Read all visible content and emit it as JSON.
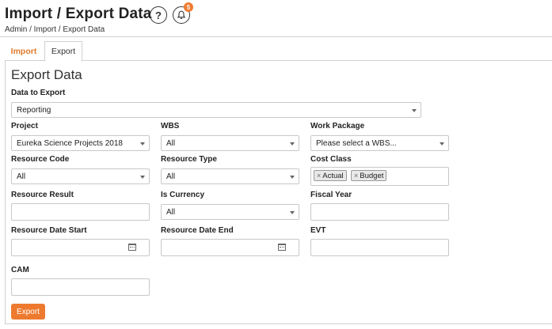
{
  "header": {
    "title": "Import / Export Data",
    "breadcrumb": "Admin  /  Import / Export Data",
    "help_glyph": "?",
    "notification_count": "5",
    "accent_color": "#ee7a2f"
  },
  "tabs": [
    {
      "label": "Import",
      "active": false
    },
    {
      "label": "Export",
      "active": true
    }
  ],
  "form": {
    "section_title": "Export Data",
    "data_to_export": {
      "label": "Data to Export",
      "value": "Reporting"
    },
    "project": {
      "label": "Project",
      "value": "Eureka Science Projects 2018"
    },
    "wbs": {
      "label": "WBS",
      "value": "All"
    },
    "work_package": {
      "label": "Work Package",
      "value": "Please select a WBS..."
    },
    "resource_code": {
      "label": "Resource Code",
      "value": "All"
    },
    "resource_type": {
      "label": "Resource Type",
      "value": "All"
    },
    "cost_class": {
      "label": "Cost Class",
      "tags": [
        "Actual",
        "Budget"
      ],
      "remove_glyph": "×"
    },
    "resource_result": {
      "label": "Resource Result",
      "value": ""
    },
    "is_currency": {
      "label": "Is Currency",
      "value": "All"
    },
    "fiscal_year": {
      "label": "Fiscal Year",
      "value": ""
    },
    "resource_date_start": {
      "label": "Resource Date Start",
      "value": ""
    },
    "resource_date_end": {
      "label": "Resource Date End",
      "value": ""
    },
    "evt": {
      "label": "EVT",
      "value": ""
    },
    "cam": {
      "label": "CAM",
      "value": ""
    },
    "export_button_label": "Export"
  }
}
